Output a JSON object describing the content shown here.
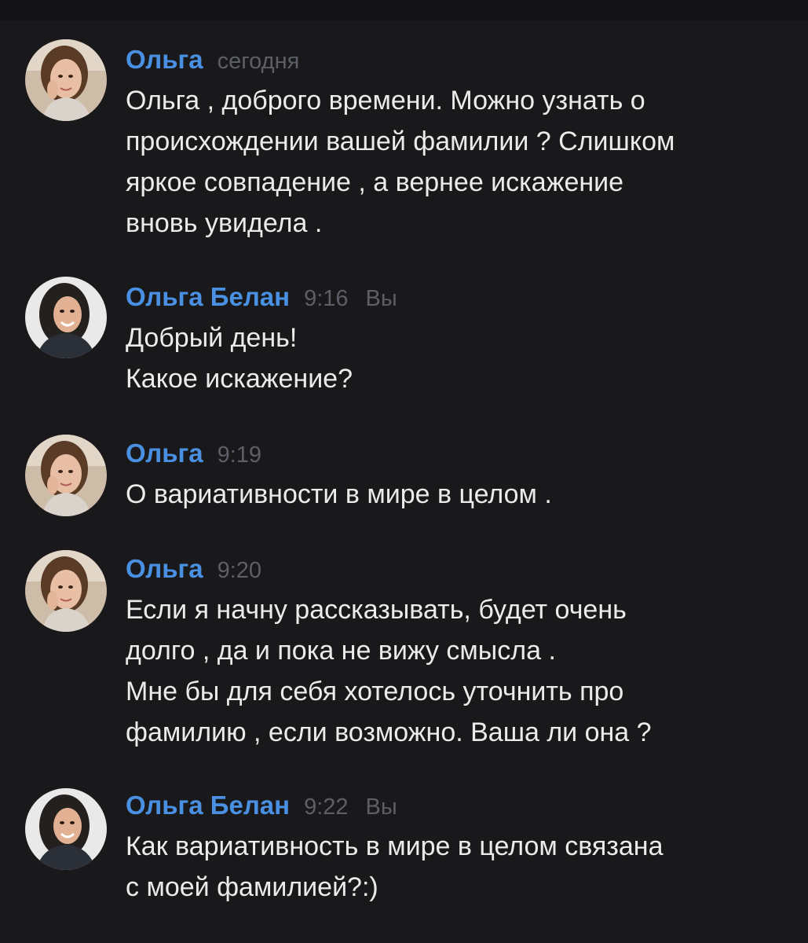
{
  "colors": {
    "background": "#19191b",
    "author": "#4a90e2",
    "meta": "#5c5f66",
    "text": "#ebebeb"
  },
  "messages": [
    {
      "author": "Ольга",
      "time": "сегодня",
      "self_label": "",
      "avatar": "avatar-olga-icon",
      "lines": [
        "Ольга , доброго времени. Можно узнать о",
        "происхождении вашей фамилии ? Слишком",
        "яркое совпадение , а вернее искажение",
        "вновь увидела ."
      ]
    },
    {
      "author": "Ольга Белан",
      "time": "9:16",
      "self_label": "Вы",
      "avatar": "avatar-olga-belan-icon",
      "lines": [
        "Добрый день!",
        "Какое искажение?"
      ]
    },
    {
      "author": "Ольга",
      "time": "9:19",
      "self_label": "",
      "avatar": "avatar-olga-icon",
      "lines": [
        "О вариативности в мире в целом ."
      ]
    },
    {
      "author": "Ольга",
      "time": "9:20",
      "self_label": "",
      "avatar": "avatar-olga-icon",
      "lines": [
        "Если я начну рассказывать, будет очень",
        "долго , да и пока не вижу смысла .",
        "Мне бы для себя хотелось уточнить про",
        "фамилию , если возможно. Ваша ли она ?"
      ]
    },
    {
      "author": "Ольга Белан",
      "time": "9:22",
      "self_label": "Вы",
      "avatar": "avatar-olga-belan-icon",
      "lines": [
        "Как вариативность в мире в целом связана",
        "с моей фамилией?:)"
      ]
    }
  ]
}
